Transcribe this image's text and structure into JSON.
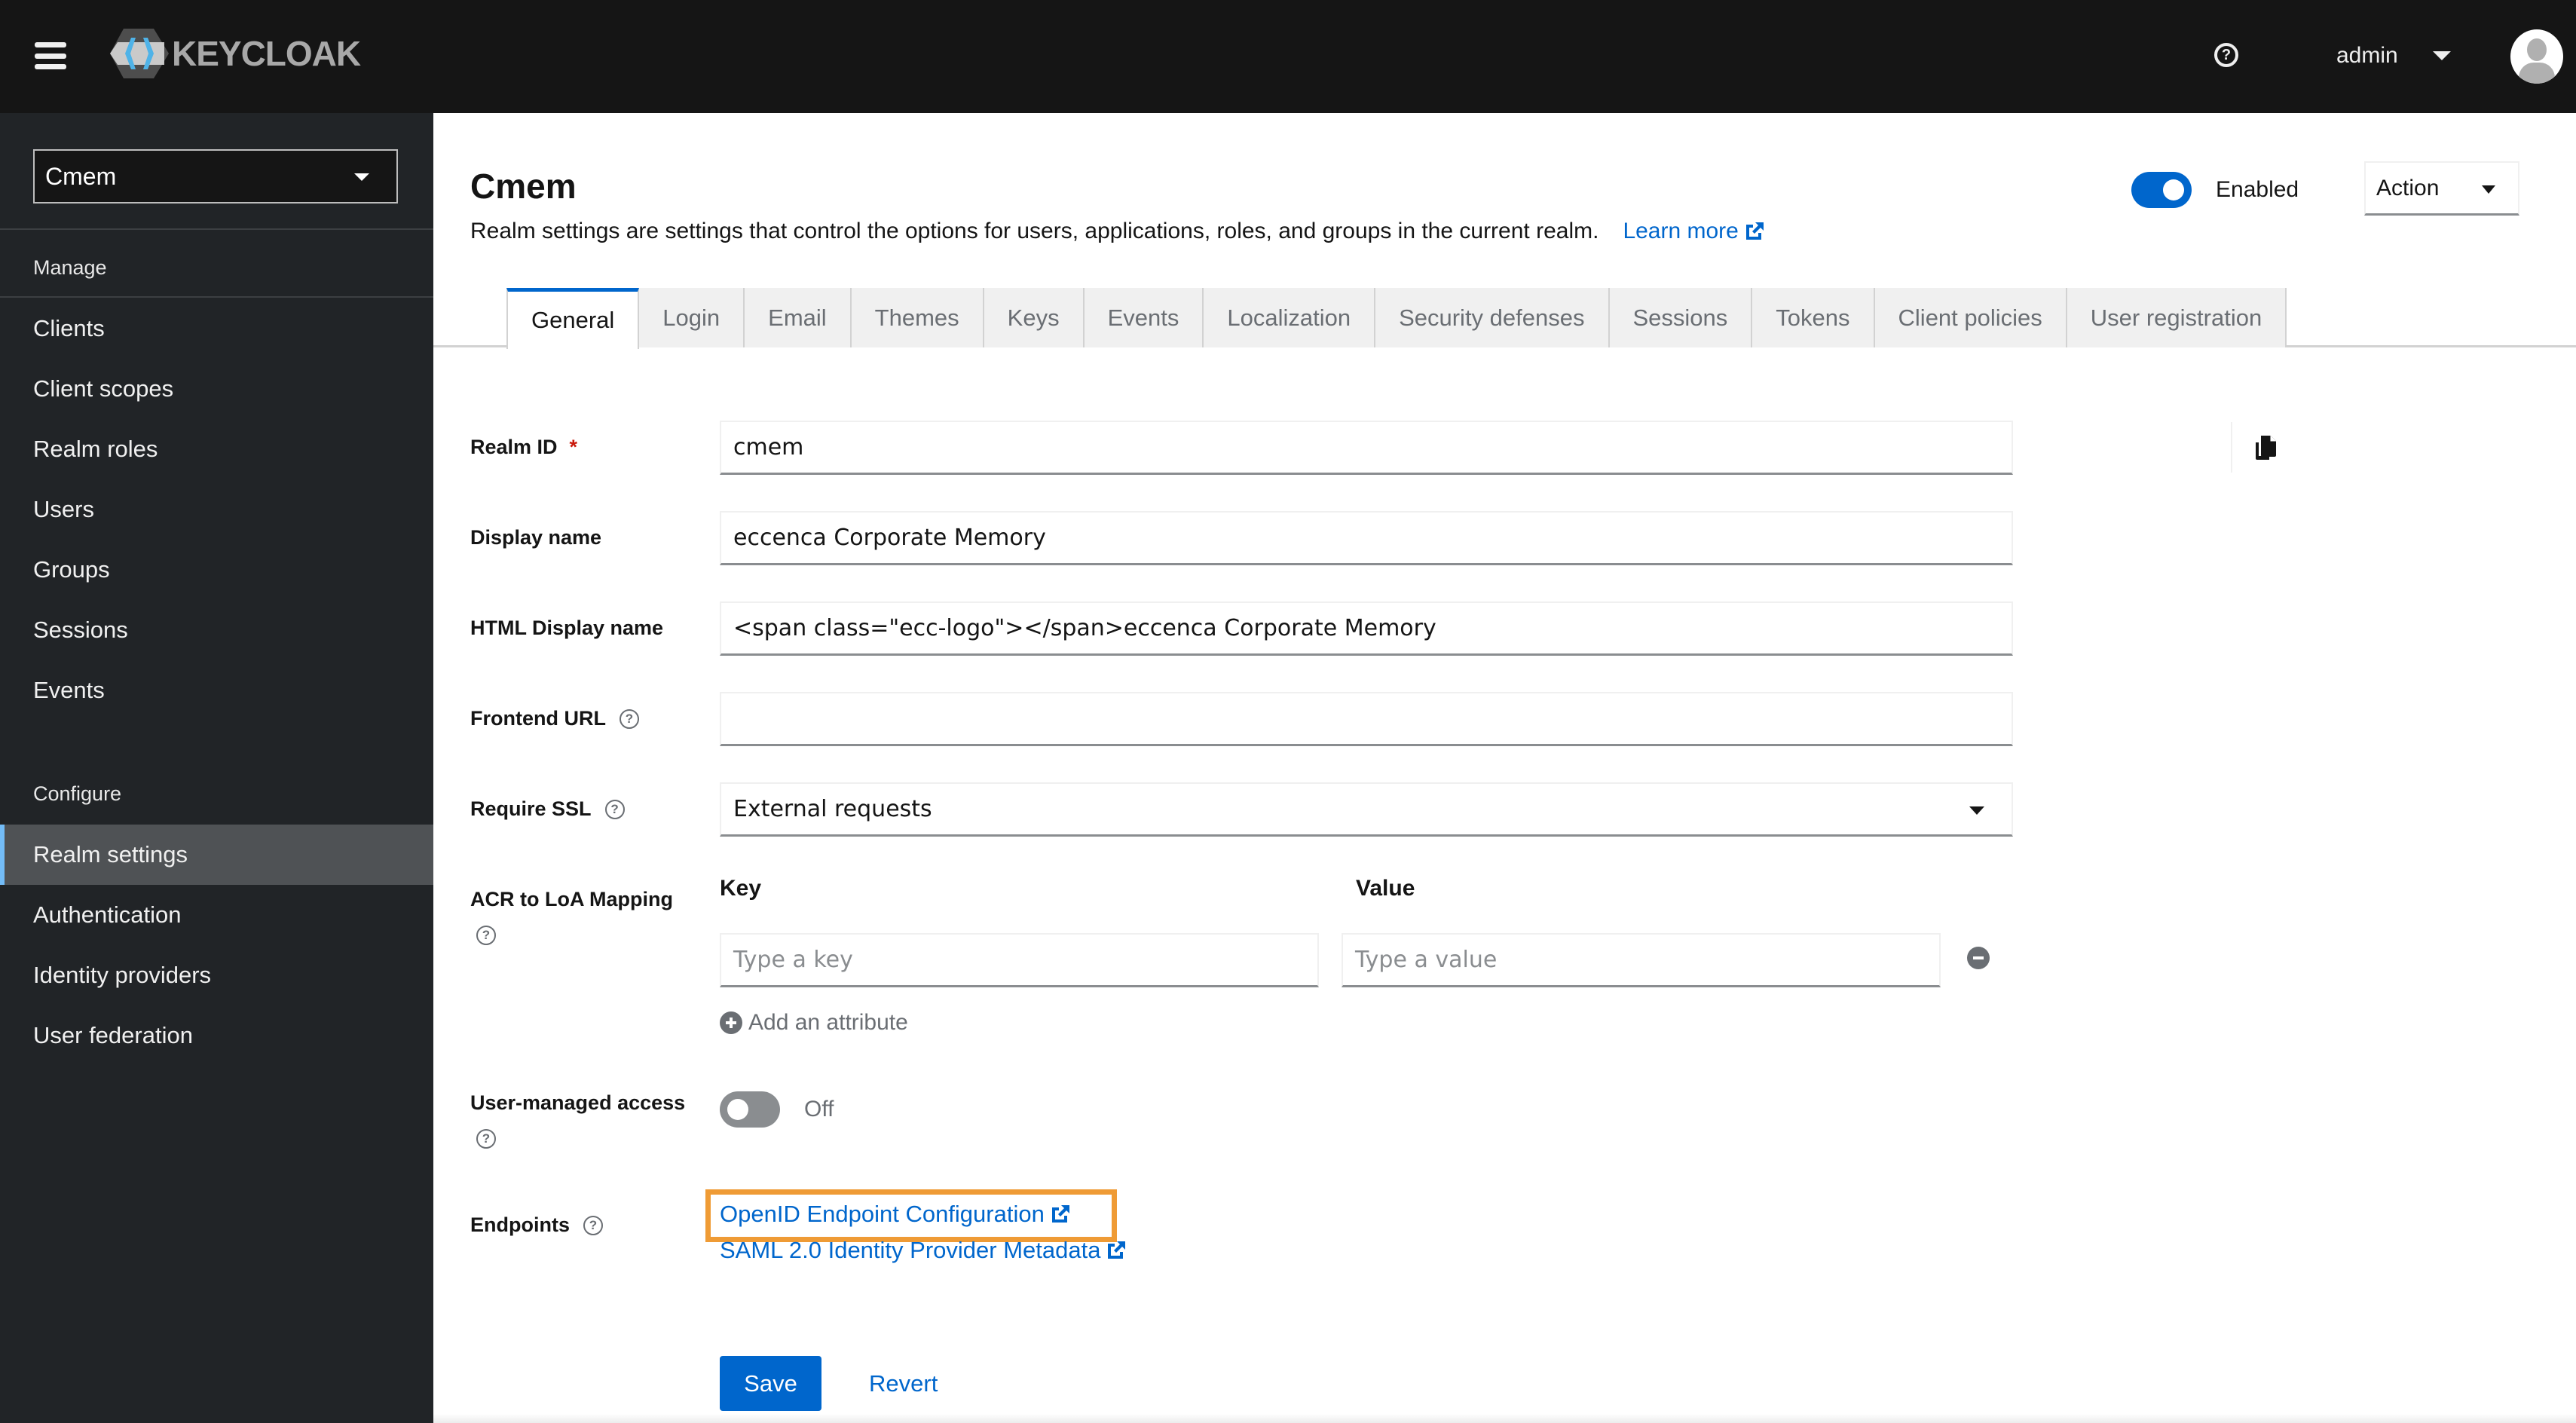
{
  "header": {
    "logo_text": "KEYCLOAK",
    "user_name": "admin",
    "icons": {
      "menu": "hamburger-icon",
      "help": "question-circle-icon",
      "user_caret": "caret-down-icon",
      "avatar": "user-avatar-icon"
    }
  },
  "sidebar": {
    "realm_selector": {
      "value": "Cmem"
    },
    "manage_title": "Manage",
    "manage_items": [
      {
        "label": "Clients"
      },
      {
        "label": "Client scopes"
      },
      {
        "label": "Realm roles"
      },
      {
        "label": "Users"
      },
      {
        "label": "Groups"
      },
      {
        "label": "Sessions"
      },
      {
        "label": "Events"
      }
    ],
    "configure_title": "Configure",
    "configure_items": [
      {
        "label": "Realm settings",
        "active": true
      },
      {
        "label": "Authentication"
      },
      {
        "label": "Identity providers"
      },
      {
        "label": "User federation"
      }
    ]
  },
  "page": {
    "title": "Cmem",
    "description": "Realm settings are settings that control the options for users, applications, roles, and groups in the current realm.",
    "learn_more": "Learn more",
    "enabled_toggle": {
      "label": "Enabled",
      "on": true
    },
    "action_button": "Action",
    "tabs": [
      {
        "label": "General",
        "active": true
      },
      {
        "label": "Login"
      },
      {
        "label": "Email"
      },
      {
        "label": "Themes"
      },
      {
        "label": "Keys"
      },
      {
        "label": "Events"
      },
      {
        "label": "Localization"
      },
      {
        "label": "Security defenses"
      },
      {
        "label": "Sessions"
      },
      {
        "label": "Tokens"
      },
      {
        "label": "Client policies"
      },
      {
        "label": "User registration"
      }
    ]
  },
  "form": {
    "realm_id": {
      "label": "Realm ID",
      "required_mark": "*",
      "value": "cmem"
    },
    "display_name": {
      "label": "Display name",
      "value": "eccenca Corporate Memory"
    },
    "html_display_name": {
      "label": "HTML Display name",
      "value": "<span class=\"ecc-logo\"></span>eccenca Corporate Memory"
    },
    "frontend_url": {
      "label": "Frontend URL",
      "value": ""
    },
    "require_ssl": {
      "label": "Require SSL",
      "value": "External requests"
    },
    "acr_mapping": {
      "label": "ACR to LoA Mapping",
      "key_header": "Key",
      "value_header": "Value",
      "key_placeholder": "Type a key",
      "value_placeholder": "Type a value",
      "add_label": "Add an attribute"
    },
    "user_managed_access": {
      "label": "User-managed access",
      "state_label": "Off",
      "on": false
    },
    "endpoints": {
      "label": "Endpoints",
      "links": [
        {
          "label": "OpenID Endpoint Configuration",
          "highlighted": true
        },
        {
          "label": "SAML 2.0 Identity Provider Metadata"
        }
      ]
    },
    "save_label": "Save",
    "revert_label": "Revert"
  },
  "colors": {
    "accent": "#0066cc",
    "highlight_box": "#ef9b35",
    "masthead": "#151515",
    "sidebar": "#212427",
    "required": "#c9190b"
  }
}
